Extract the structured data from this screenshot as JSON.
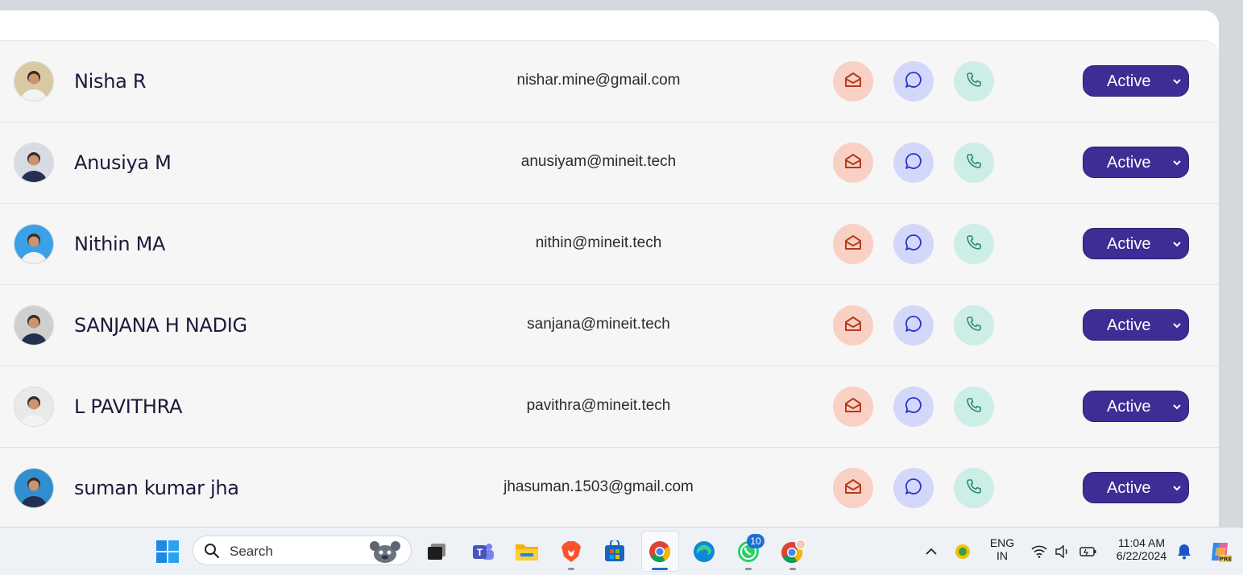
{
  "contacts": [
    {
      "name": "Nisha R",
      "email": "nishar.mine@gmail.com",
      "status": "Active",
      "avatar_color": "#d9c9a3"
    },
    {
      "name": "Anusiya M",
      "email": "anusiyam@mineit.tech",
      "status": "Active",
      "avatar_color": "#d8dce2"
    },
    {
      "name": "Nithin MA",
      "email": "nithin@mineit.tech",
      "status": "Active",
      "avatar_color": "#3aa0e8"
    },
    {
      "name": "SANJANA H NADIG",
      "email": "sanjana@mineit.tech",
      "status": "Active",
      "avatar_color": "#cfcfcf"
    },
    {
      "name": "L PAVITHRA",
      "email": "pavithra@mineit.tech",
      "status": "Active",
      "avatar_color": "#e9e9e9"
    },
    {
      "name": "suman kumar jha",
      "email": "jhasuman.1503@gmail.com",
      "status": "Active",
      "avatar_color": "#2f8fd0"
    }
  ],
  "colors": {
    "status_bg": "#3c2e95",
    "mail_bg": "#f9d0c4",
    "chat_bg": "#d3d8fa",
    "call_bg": "#cdeee6",
    "name_text": "#1c1a3a"
  },
  "icons": {
    "mail": "envelope-open-icon",
    "chat": "chat-bubble-icon",
    "call": "phone-icon",
    "status_dropdown": "chevron-down-icon"
  },
  "taskbar": {
    "search_placeholder": "Search",
    "lang_line1": "ENG",
    "lang_line2": "IN",
    "time": "11:04 AM",
    "date": "6/22/2024",
    "whatsapp_badge": "10",
    "apps": [
      "windows-start",
      "search",
      "task-view",
      "teams",
      "file-explorer",
      "brave",
      "microsoft-store",
      "chrome",
      "edge",
      "whatsapp",
      "chrome-profile"
    ]
  }
}
